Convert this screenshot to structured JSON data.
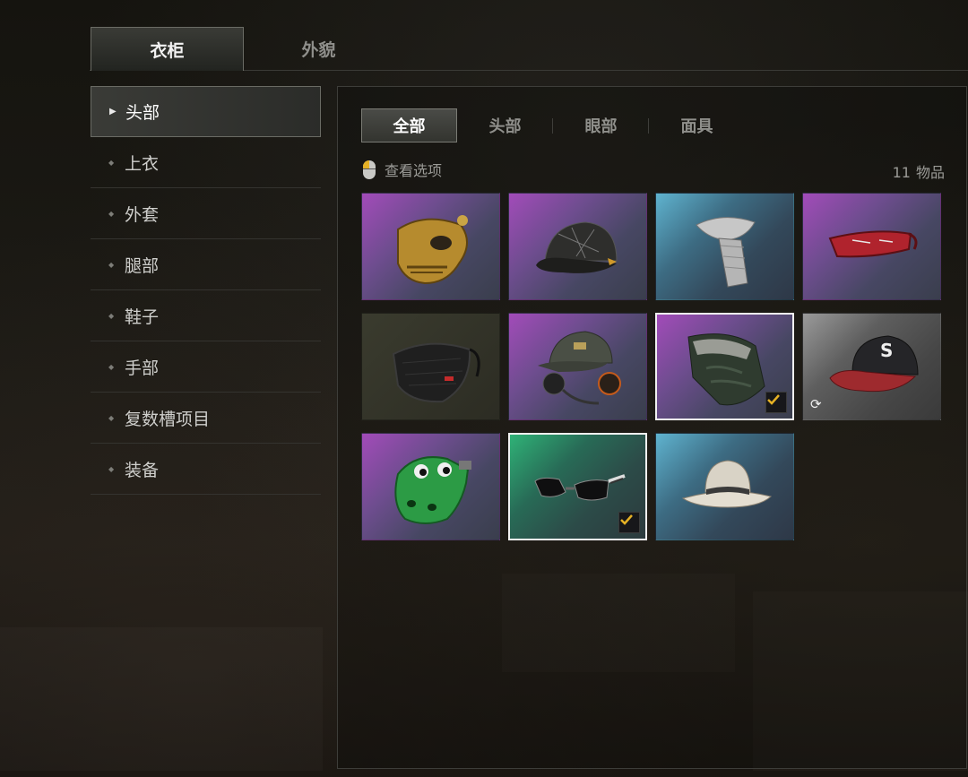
{
  "top_tabs": [
    {
      "label": "衣柜",
      "active": true
    },
    {
      "label": "外貌",
      "active": false
    }
  ],
  "sidebar": {
    "items": [
      {
        "label": "头部",
        "active": true
      },
      {
        "label": "上衣",
        "active": false
      },
      {
        "label": "外套",
        "active": false
      },
      {
        "label": "腿部",
        "active": false
      },
      {
        "label": "鞋子",
        "active": false
      },
      {
        "label": "手部",
        "active": false
      },
      {
        "label": "复数槽项目",
        "active": false
      },
      {
        "label": "装备",
        "active": false
      }
    ]
  },
  "filter_tabs": [
    {
      "label": "全部",
      "active": true
    },
    {
      "label": "头部",
      "active": false
    },
    {
      "label": "眼部",
      "active": false
    },
    {
      "label": "面具",
      "active": false
    }
  ],
  "options_label": "查看选项",
  "item_count": {
    "number": "11",
    "unit": "物品"
  },
  "items": [
    {
      "icon": "gold-skull-mask-icon",
      "rarity": "purple",
      "equipped": false,
      "selected": false
    },
    {
      "icon": "black-cap-icon",
      "rarity": "purple",
      "equipped": false,
      "selected": false
    },
    {
      "icon": "grey-scarf-icon",
      "rarity": "blue",
      "equipped": false,
      "selected": false
    },
    {
      "icon": "red-visor-icon",
      "rarity": "purple",
      "equipped": false,
      "selected": false
    },
    {
      "icon": "black-face-mask-icon",
      "rarity": "olive",
      "equipped": false,
      "selected": false
    },
    {
      "icon": "headset-cap-icon",
      "rarity": "purple",
      "equipped": false,
      "selected": false
    },
    {
      "icon": "camo-bandana-icon",
      "rarity": "purple",
      "equipped": true,
      "selected": true
    },
    {
      "icon": "red-black-cap-icon",
      "rarity": "grey",
      "equipped": false,
      "selected": false,
      "cycle": true
    },
    {
      "icon": "green-dino-mask-icon",
      "rarity": "purple",
      "equipped": false,
      "selected": false
    },
    {
      "icon": "sunglasses-icon",
      "rarity": "green",
      "equipped": true,
      "selected": true
    },
    {
      "icon": "fedora-hat-icon",
      "rarity": "blue",
      "equipped": false,
      "selected": false
    }
  ],
  "colors": {
    "accent": "#e5b125",
    "selected_border": "#f1f1f1"
  }
}
